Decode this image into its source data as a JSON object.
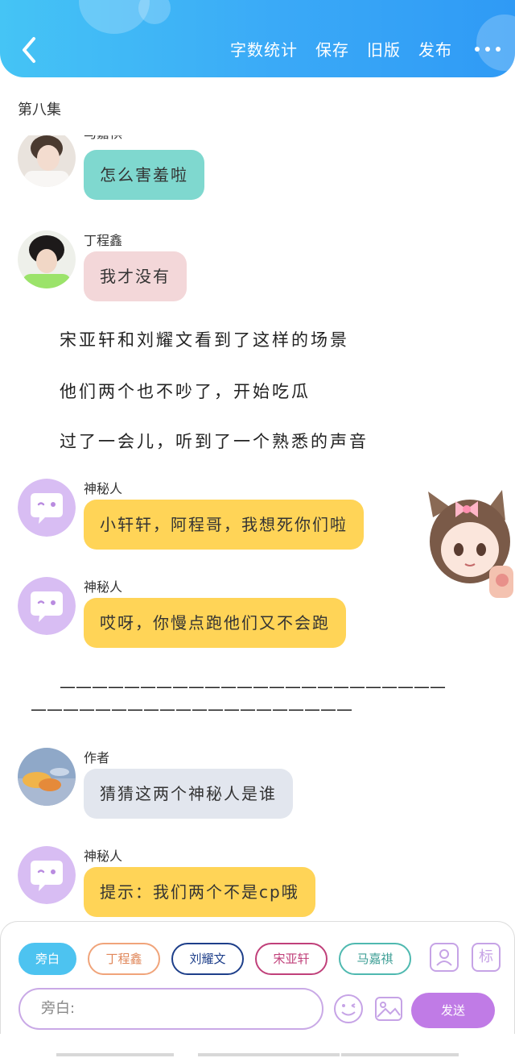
{
  "header": {
    "actions": [
      "字数统计",
      "保存",
      "旧版",
      "发布"
    ],
    "colors": {
      "start": "#45c4f5",
      "end": "#2f9af5"
    }
  },
  "episode_title": "第八集",
  "chat": {
    "messages": [
      {
        "sender": "马嘉祺",
        "text": "怎么害羞啦",
        "bubble_color": "#7fd8cf",
        "avatar": "boy-photo-avatar"
      },
      {
        "sender": "丁程鑫",
        "text": "我才没有",
        "bubble_color": "#f3d7d9",
        "avatar": "boy-photo-avatar"
      },
      {
        "sender": "神秘人",
        "text": "小轩轩，阿程哥，我想死你们啦",
        "bubble_color": "#ffd457",
        "avatar": "chat-bubble-avatar"
      },
      {
        "sender": "神秘人",
        "text": "哎呀，你慢点跑他们又不会跑",
        "bubble_color": "#ffd457",
        "avatar": "chat-bubble-avatar"
      },
      {
        "sender": "作者",
        "text": "猜猜这两个神秘人是谁",
        "bubble_color": "#e2e6ee",
        "avatar": "sky-photo-avatar"
      },
      {
        "sender": "神秘人",
        "text": "提示：我们两个不是cp哦",
        "bubble_color": "#ffd457",
        "avatar": "chat-bubble-avatar"
      }
    ],
    "narration": [
      "宋亚轩和刘耀文看到了这样的场景",
      "他们两个也不吵了，开始吃瓜",
      "过了一会儿，听到了一个熟悉的声音"
    ],
    "divider": {
      "line1": "————————————————————————",
      "line2": "————————————————————"
    }
  },
  "composer": {
    "roles": [
      {
        "label": "旁白",
        "color": "#4dc3f0",
        "selected": true
      },
      {
        "label": "丁程鑫",
        "color": "#f0a47a",
        "selected": false
      },
      {
        "label": "刘耀文",
        "color": "#1e3f8a",
        "selected": false
      },
      {
        "label": "宋亚轩",
        "color": "#c0407a",
        "selected": false
      },
      {
        "label": "马嘉祺",
        "color": "#4fb9b0",
        "selected": false
      }
    ],
    "input_placeholder": "旁白:",
    "send_label": "发送",
    "tag_icon_label": "标"
  }
}
